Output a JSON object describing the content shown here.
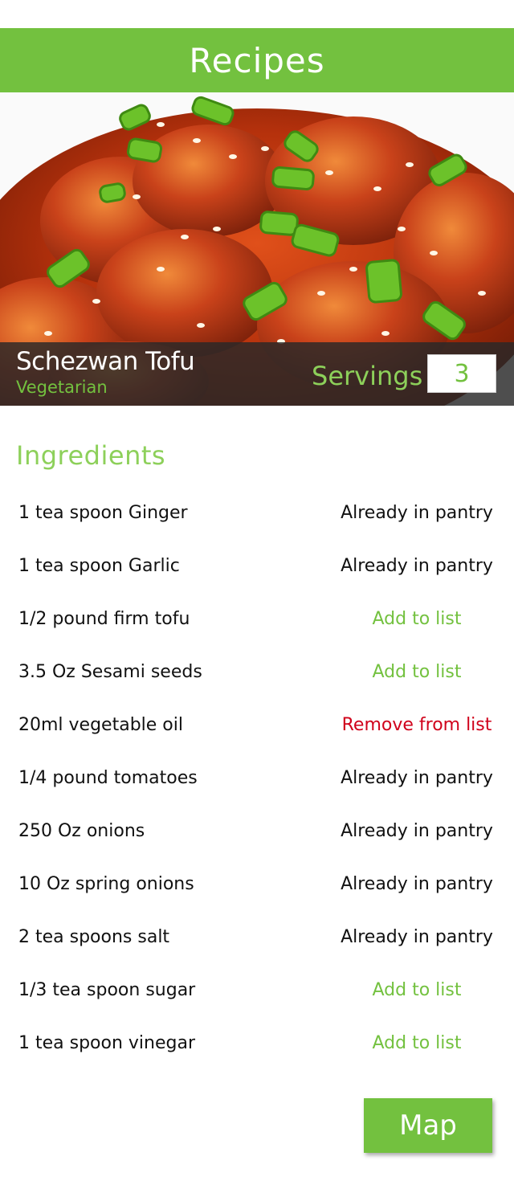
{
  "header": {
    "title": "Recipes"
  },
  "recipe": {
    "name": "Schezwan Tofu",
    "category": "Vegetarian",
    "servings_label": "Servings",
    "servings_value": "3"
  },
  "ingredients_title": "Ingredients",
  "ingredients": [
    {
      "name": "1 tea spoon Ginger",
      "action": "Already in pantry"
    },
    {
      "name": "1 tea spoon Garlic",
      "action": "Already in pantry"
    },
    {
      "name": "1/2 pound firm tofu",
      "action": "Add to list"
    },
    {
      "name": "3.5 Oz Sesami seeds",
      "action": "Add to list"
    },
    {
      "name": "20ml vegetable oil",
      "action": "Remove from list"
    },
    {
      "name": "1/4 pound tomatoes",
      "action": "Already in pantry"
    },
    {
      "name": "250 Oz onions",
      "action": "Already in pantry"
    },
    {
      "name": "10 Oz spring onions",
      "action": "Already in pantry"
    },
    {
      "name": "2 tea spoons salt",
      "action": "Already in pantry"
    },
    {
      "name": "1/3 tea spoon sugar",
      "action": "Add to list"
    },
    {
      "name": "1 tea spoon vinegar",
      "action": "Add to list"
    }
  ],
  "map_button": {
    "label": "Map"
  },
  "colors": {
    "accent": "#73c13f",
    "remove": "#d0021b",
    "overlay": "#282828"
  }
}
